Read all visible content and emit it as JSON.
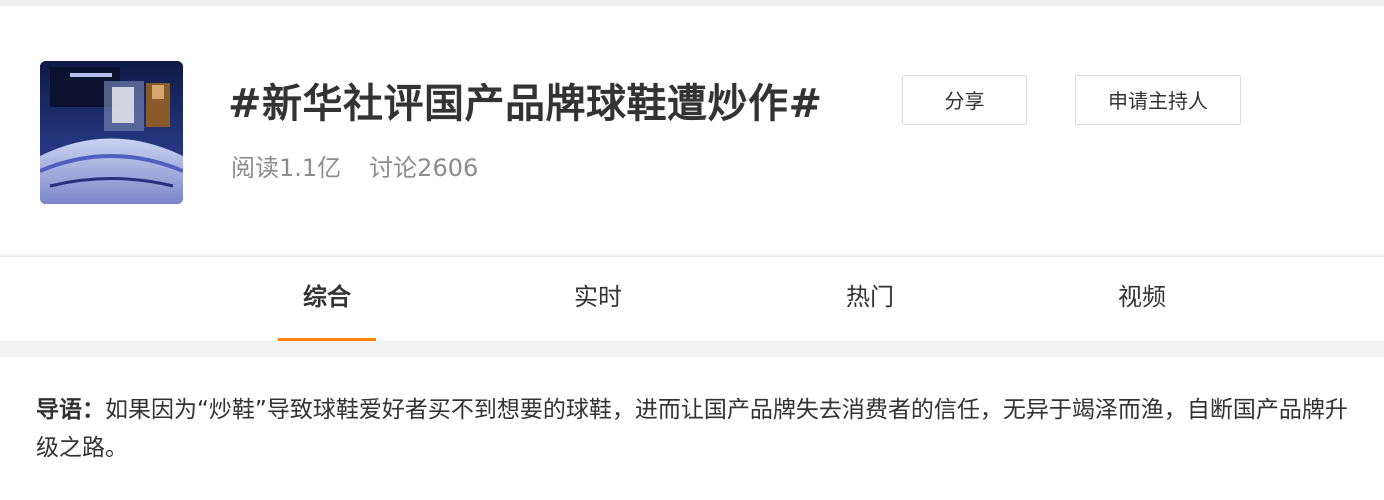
{
  "topic": {
    "title": "#新华社评国产品牌球鞋遭炒作#",
    "reads": "阅读1.1亿",
    "discussions": "讨论2606",
    "share_label": "分享",
    "apply_host_label": "申请主持人"
  },
  "tabs": [
    {
      "label": "综合",
      "active": true
    },
    {
      "label": "实时",
      "active": false
    },
    {
      "label": "热门",
      "active": false
    },
    {
      "label": "视频",
      "active": false
    }
  ],
  "intro": {
    "label": "导语：",
    "text": "如果因为“炒鞋”导致球鞋爱好者买不到想要的球鞋，进而让国产品牌失去消费者的信任，无异于竭泽而渔，自断国产品牌升级之路。"
  },
  "colors": {
    "accent": "#ff8200"
  }
}
